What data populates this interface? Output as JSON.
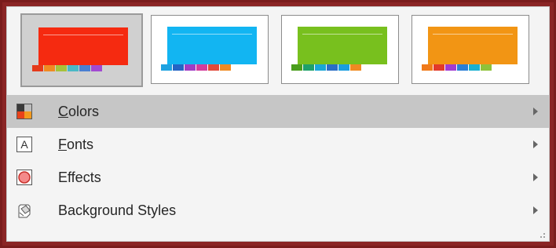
{
  "themes": [
    {
      "name": "red",
      "slide": "#f52a10",
      "bars": [
        "#e53a1a",
        "#f08a22",
        "#a6c23a",
        "#4ab8c6",
        "#4a7fd2",
        "#a24ad2"
      ],
      "selected": true
    },
    {
      "name": "blue",
      "slide": "#12b5f2",
      "bars": [
        "#1ea2e0",
        "#2464c4",
        "#a03cc4",
        "#d43c9c",
        "#e24a3a",
        "#f08a22"
      ],
      "selected": false
    },
    {
      "name": "green",
      "slide": "#78c01e",
      "bars": [
        "#4a9e1c",
        "#1ea06a",
        "#1aa6d6",
        "#2a6ec6",
        "#1a9ee0",
        "#f08a22"
      ],
      "selected": false
    },
    {
      "name": "orange",
      "slide": "#f29514",
      "bars": [
        "#f07a1a",
        "#e23a2a",
        "#a03cd2",
        "#2a7fd6",
        "#1ab0d0",
        "#8fc23a"
      ],
      "selected": false
    }
  ],
  "menu": {
    "colors": {
      "mnemonic": "C",
      "rest": "olors",
      "icon": "colors-icon"
    },
    "fonts": {
      "mnemonic": "F",
      "rest": "onts",
      "icon": "fonts-icon"
    },
    "effects": {
      "label": "Effects",
      "icon": "effects-icon"
    },
    "background": {
      "label": "Background Styles",
      "icon": "background-styles-icon"
    }
  },
  "icon_glyphs": {
    "fonts": "A"
  },
  "colors": {
    "frame": "#8a2525",
    "hover": "#c6c6c6"
  }
}
